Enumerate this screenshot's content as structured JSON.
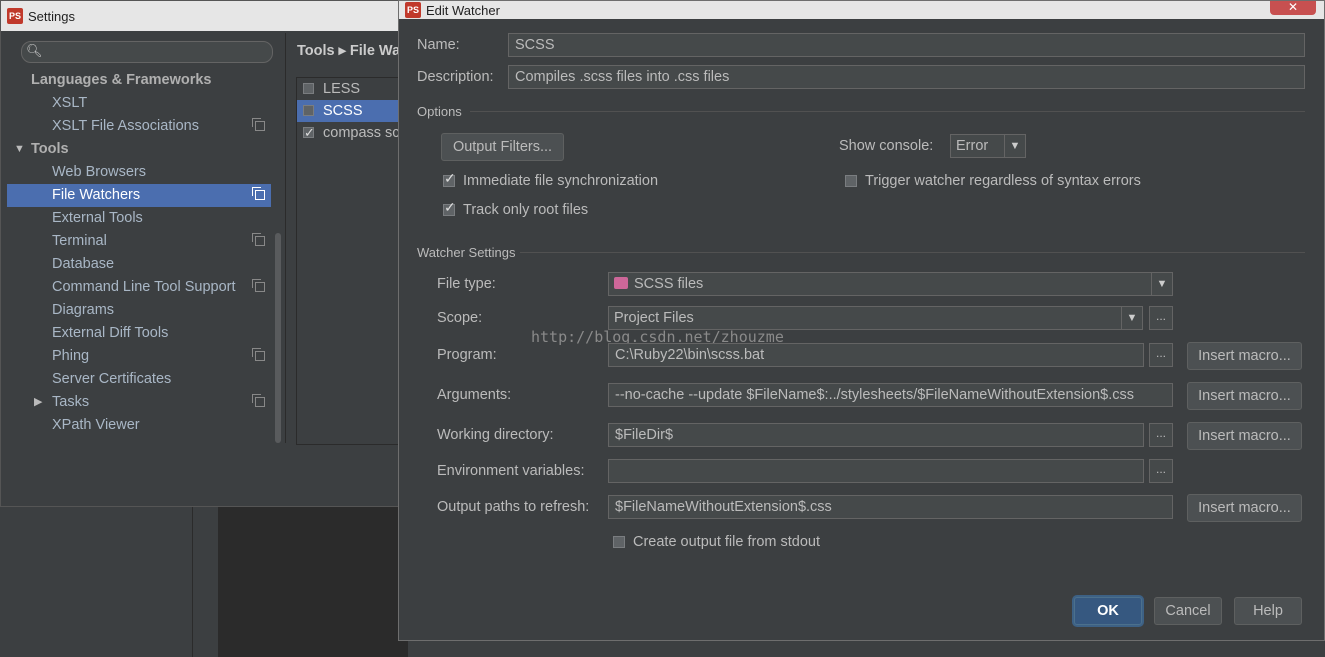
{
  "settings": {
    "title": "Settings",
    "search": {
      "placeholder": ""
    },
    "tree": [
      {
        "label": "Languages & Frameworks"
      },
      {
        "label": "XSLT"
      },
      {
        "label": "XSLT File Associations"
      },
      {
        "label": "Tools"
      },
      {
        "label": "Web Browsers"
      },
      {
        "label": "File Watchers"
      },
      {
        "label": "External Tools"
      },
      {
        "label": "Terminal"
      },
      {
        "label": "Database"
      },
      {
        "label": "Command Line Tool Support"
      },
      {
        "label": "Diagrams"
      },
      {
        "label": "External Diff Tools"
      },
      {
        "label": "Phing"
      },
      {
        "label": "Server Certificates"
      },
      {
        "label": "Tasks"
      },
      {
        "label": "XPath Viewer"
      }
    ],
    "breadcrumb": "Tools ▸ File Wa",
    "watchers": [
      {
        "label": "LESS",
        "checked": false
      },
      {
        "label": "SCSS",
        "checked": false
      },
      {
        "label": "compass sc",
        "checked": true
      }
    ]
  },
  "dialog": {
    "title": "Edit Watcher",
    "close_icon": "close-icon",
    "name_label": "Name:",
    "name_value": "SCSS",
    "description_label": "Description:",
    "description_value": "Compiles .scss files into .css files",
    "options_title": "Options",
    "output_filters_label": "Output Filters...",
    "show_console_label": "Show console:",
    "show_console_value": "Error",
    "immediate_sync_label": "Immediate file synchronization",
    "track_root_label": "Track only root files",
    "trigger_label": "Trigger watcher regardless of syntax errors",
    "watcher_settings_title": "Watcher Settings",
    "file_type_label": "File type:",
    "file_type_value": "SCSS files",
    "scope_label": "Scope:",
    "scope_value": "Project Files",
    "program_label": "Program:",
    "program_value": "C:\\Ruby22\\bin\\scss.bat",
    "arguments_label": "Arguments:",
    "arguments_value": "--no-cache --update $FileName$:../stylesheets/$FileNameWithoutExtension$.css",
    "working_dir_label": "Working directory:",
    "working_dir_value": "$FileDir$",
    "env_vars_label": "Environment variables:",
    "env_vars_value": "",
    "output_paths_label": "Output paths to refresh:",
    "output_paths_value": "$FileNameWithoutExtension$.css",
    "create_output_label": "Create output file from stdout",
    "insert_macro_label": "Insert macro...",
    "dots_label": "...",
    "ok_label": "OK",
    "cancel_label": "Cancel",
    "help_label": "Help",
    "watermark": "http://blog.csdn.net/zhouzme"
  },
  "colors": {
    "accent": "#4b6eaf",
    "primary_button": "#365880",
    "background": "#3c3f41"
  }
}
